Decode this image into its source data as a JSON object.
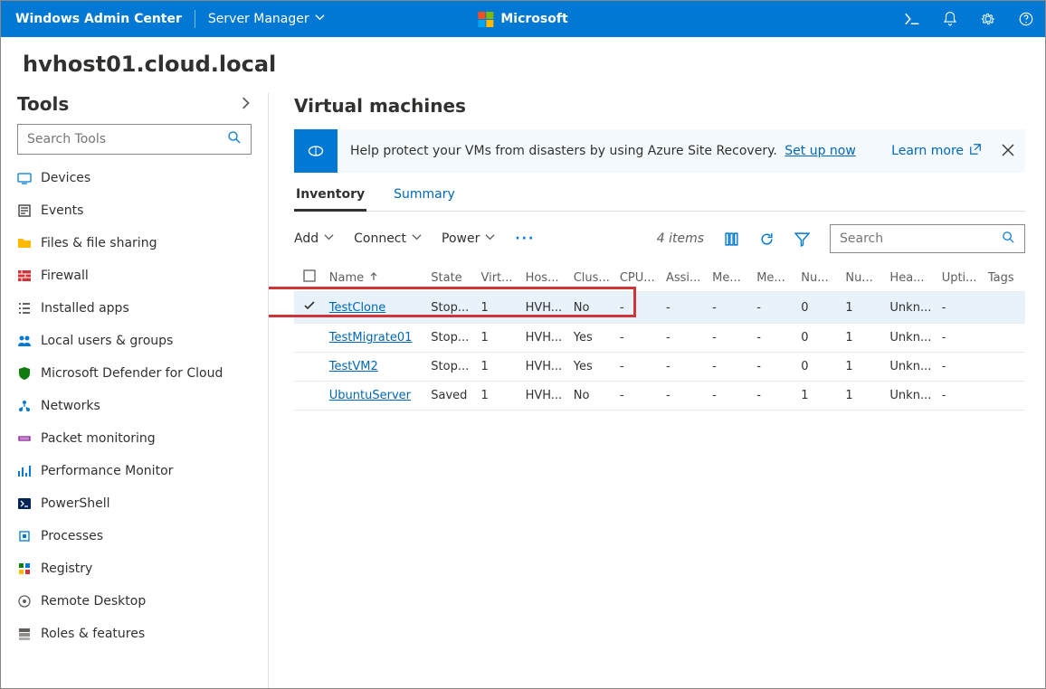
{
  "topbar": {
    "brand": "Windows Admin Center",
    "context": "Server Manager",
    "ms_label": "Microsoft"
  },
  "page_title": "hvhost01.cloud.local",
  "sidebar": {
    "title": "Tools",
    "search_placeholder": "Search Tools",
    "items": [
      {
        "label": "Devices",
        "icon": "device"
      },
      {
        "label": "Events",
        "icon": "events"
      },
      {
        "label": "Files & file sharing",
        "icon": "folder"
      },
      {
        "label": "Firewall",
        "icon": "firewall"
      },
      {
        "label": "Installed apps",
        "icon": "list"
      },
      {
        "label": "Local users & groups",
        "icon": "users"
      },
      {
        "label": "Microsoft Defender for Cloud",
        "icon": "shield"
      },
      {
        "label": "Networks",
        "icon": "network"
      },
      {
        "label": "Packet monitoring",
        "icon": "packet"
      },
      {
        "label": "Performance Monitor",
        "icon": "perf"
      },
      {
        "label": "PowerShell",
        "icon": "ps"
      },
      {
        "label": "Processes",
        "icon": "proc"
      },
      {
        "label": "Registry",
        "icon": "registry"
      },
      {
        "label": "Remote Desktop",
        "icon": "rdp"
      },
      {
        "label": "Roles & features",
        "icon": "roles"
      }
    ]
  },
  "main": {
    "heading": "Virtual machines",
    "banner": {
      "text": "Help protect your VMs from disasters by using Azure Site Recovery.",
      "setup": "Set up now",
      "learn": "Learn more"
    },
    "tabs": {
      "inventory": "Inventory",
      "summary": "Summary"
    },
    "toolbar": {
      "add": "Add",
      "connect": "Connect",
      "power": "Power",
      "count": "4 items",
      "search_placeholder": "Search"
    },
    "columns": [
      "",
      "Name",
      "State",
      "Virt...",
      "Hos...",
      "Clus...",
      "CPU...",
      "Assi...",
      "Me...",
      "Me...",
      "Nu...",
      "Nu...",
      "Hea...",
      "Upti...",
      "Tags"
    ],
    "rows": [
      {
        "sel": true,
        "name": "TestClone",
        "state": "Stop...",
        "virt": "1",
        "host": "HVH...",
        "clus": "No",
        "cpu": "-",
        "assi": "-",
        "me1": "-",
        "me2": "-",
        "nu1": "0",
        "nu2": "1",
        "hea": "Unkn...",
        "upti": "-",
        "tags": ""
      },
      {
        "sel": false,
        "name": "TestMigrate01",
        "state": "Stop...",
        "virt": "1",
        "host": "HVH...",
        "clus": "Yes",
        "cpu": "-",
        "assi": "-",
        "me1": "-",
        "me2": "-",
        "nu1": "0",
        "nu2": "1",
        "hea": "Unkn...",
        "upti": "-",
        "tags": ""
      },
      {
        "sel": false,
        "name": "TestVM2",
        "state": "Stop...",
        "virt": "1",
        "host": "HVH...",
        "clus": "Yes",
        "cpu": "-",
        "assi": "-",
        "me1": "-",
        "me2": "-",
        "nu1": "0",
        "nu2": "1",
        "hea": "Unkn...",
        "upti": "-",
        "tags": ""
      },
      {
        "sel": false,
        "name": "UbuntuServer",
        "state": "Saved",
        "virt": "1",
        "host": "HVH...",
        "clus": "No",
        "cpu": "-",
        "assi": "-",
        "me1": "-",
        "me2": "-",
        "nu1": "1",
        "nu2": "1",
        "hea": "Unkn...",
        "upti": "-",
        "tags": ""
      }
    ]
  }
}
